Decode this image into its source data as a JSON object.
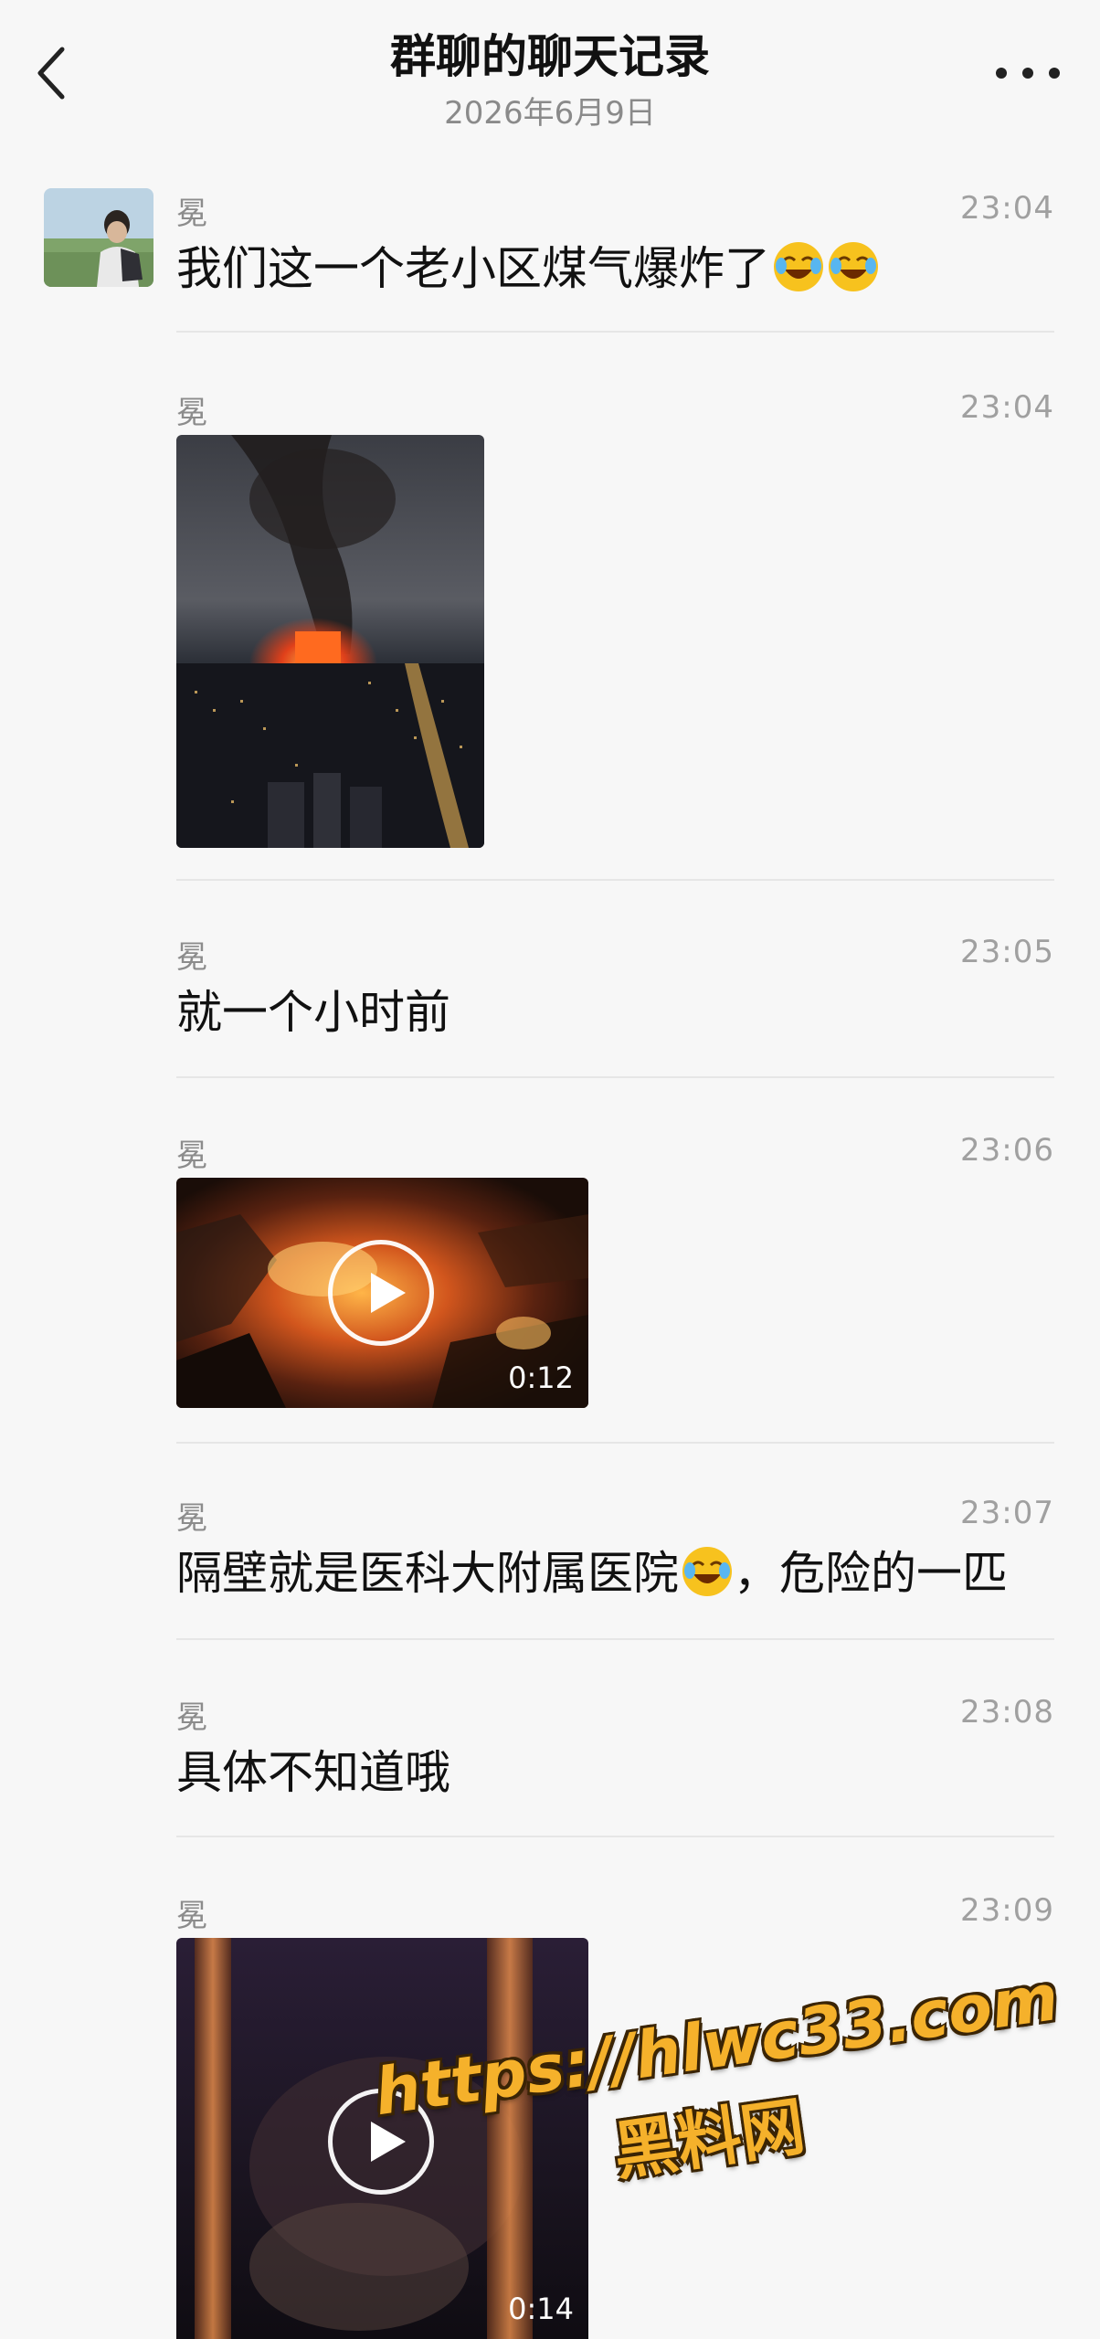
{
  "header": {
    "title": "群聊的聊天记录",
    "date": "2026年6月9日",
    "back_icon": "chevron-left-icon",
    "more_icon": "ellipsis-icon"
  },
  "messages": [
    {
      "sender": "冕",
      "time": "23:04",
      "type": "text",
      "text": "我们这一个老小区煤气爆炸了",
      "emoji_after": [
        "crying-laughing-emoji",
        "crying-laughing-emoji"
      ]
    },
    {
      "sender": "冕",
      "time": "23:04",
      "type": "image",
      "description_icon": "fire-photo"
    },
    {
      "sender": "冕",
      "time": "23:05",
      "type": "text",
      "text": "就一个小时前"
    },
    {
      "sender": "冕",
      "time": "23:06",
      "type": "video",
      "duration": "0:12"
    },
    {
      "sender": "冕",
      "time": "23:07",
      "type": "text",
      "text_before_emoji": "隔壁就是医科大附属医院",
      "text_after_emoji": "，危险的一匹"
    },
    {
      "sender": "冕",
      "time": "23:08",
      "type": "text",
      "text": "具体不知道哦"
    },
    {
      "sender": "冕",
      "time": "23:09",
      "type": "video",
      "duration": "0:14"
    }
  ],
  "watermark": {
    "url": "https://hlwc33.com",
    "name": "黑料网"
  },
  "colors": {
    "background": "#f7f7f7",
    "timestamp": "#a0a0a0",
    "watermark": "#f5b12b"
  }
}
